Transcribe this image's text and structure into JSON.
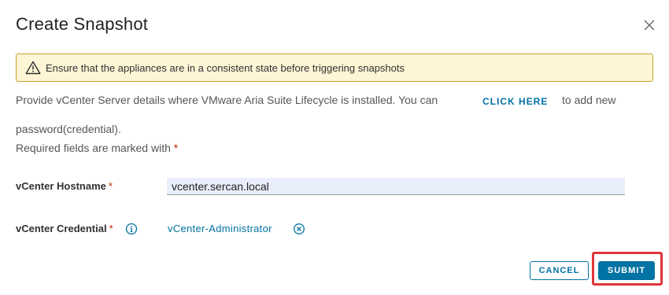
{
  "dialog": {
    "title": "Create Snapshot",
    "close_icon": "close-icon"
  },
  "alert": {
    "icon": "warning-icon",
    "text": "Ensure that the appliances are in a consistent state before triggering snapshots",
    "colors": {
      "background": "#fdf5d6",
      "border": "#c9a62c",
      "icon": "#313131"
    }
  },
  "info": {
    "line1": "Provide vCenter Server details where VMware Aria Suite Lifecycle is installed. You can",
    "link_label": "CLICK HERE",
    "line1_after": "to add new",
    "line2": "password(credential).",
    "line3": "Required fields are marked with",
    "required_marker": "*"
  },
  "form": {
    "hostname": {
      "label": "vCenter Hostname",
      "required_marker": "*",
      "value": "vcenter.sercan.local"
    },
    "credential": {
      "label": "vCenter Credential",
      "required_marker": "*",
      "info_icon": "info-icon",
      "value": "vCenter-Administrator",
      "clear_icon": "clear-icon"
    }
  },
  "footer": {
    "cancel_label": "CANCEL",
    "submit_label": "SUBMIT"
  },
  "colors": {
    "accent": "#0072a3",
    "required": "#c92100",
    "highlight": "#e0363c"
  }
}
